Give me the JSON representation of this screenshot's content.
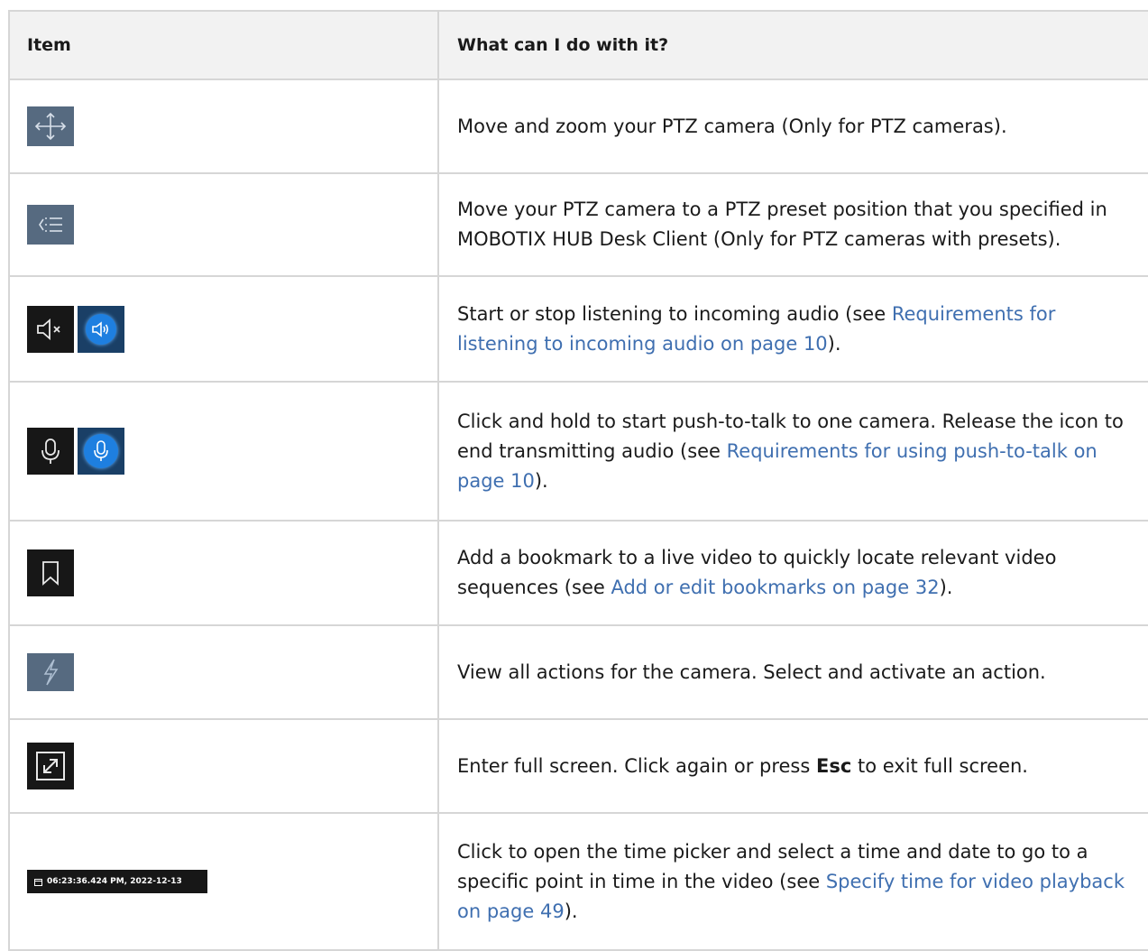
{
  "table": {
    "headers": {
      "item": "Item",
      "what": "What can I do with it?"
    },
    "rows": [
      {
        "icon": "move-arrows-icon",
        "parts": [
          "Move and zoom your PTZ camera (Only for PTZ cameras)."
        ]
      },
      {
        "icon": "preset-list-icon",
        "parts": [
          "Move your PTZ camera to a PTZ preset position that you specified in MOBOTIX HUB Desk Client (Only for PTZ cameras with presets)."
        ]
      },
      {
        "icon": "speaker-icon",
        "parts": [
          "Start or stop listening to incoming audio (see ",
          "Requirements for listening to incoming audio on page 10",
          ")."
        ]
      },
      {
        "icon": "microphone-icon",
        "parts": [
          "Click and hold to start push-to-talk to one camera. Release the icon to end transmitting audio (see ",
          "Requirements for using push-to-talk on page 10",
          ")."
        ]
      },
      {
        "icon": "bookmark-icon",
        "parts": [
          "Add a bookmark to a live video to quickly locate relevant video sequences (see ",
          "Add or edit bookmarks on page 32",
          ")."
        ]
      },
      {
        "icon": "lightning-icon",
        "parts": [
          "View all actions for the camera. Select and activate an action."
        ]
      },
      {
        "icon": "fullscreen-icon",
        "parts": [
          "Enter full screen. Click again or press ",
          "Esc",
          " to exit full screen."
        ]
      },
      {
        "icon": "time-picker-icon",
        "timestamp": "06:23:36.424 PM, 2022-12-13",
        "parts": [
          "Click to open the time picker and select a time and date to go to a specific point in time in the video (see ",
          "Specify time for video playback on page 49",
          ")."
        ]
      }
    ]
  },
  "colors": {
    "link": "#3f6fb0",
    "header_bg": "#f2f2f2",
    "border": "#d6d6d6"
  }
}
